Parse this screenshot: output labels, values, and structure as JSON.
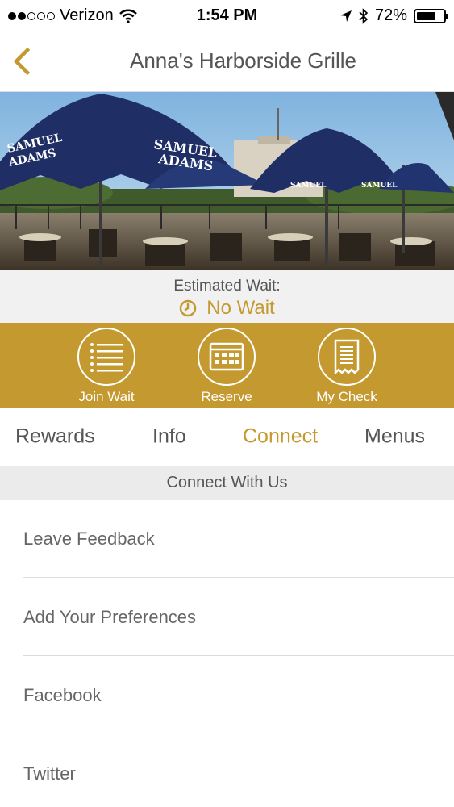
{
  "status_bar": {
    "carrier": "Verizon",
    "time": "1:54 PM",
    "battery": "72%",
    "signal_bars_filled": 2,
    "signal_bars_total": 5,
    "battery_level": 0.72
  },
  "nav": {
    "title": "Anna's Harborside Grille",
    "back_icon": "chevron-left-icon"
  },
  "hero": {
    "umbrella_text": [
      "SAMUEL",
      "ADAMS"
    ]
  },
  "wait": {
    "label": "Estimated Wait:",
    "value": "No Wait"
  },
  "actions": [
    {
      "label": "Join Wait",
      "icon": "list-icon"
    },
    {
      "label": "Reserve",
      "icon": "calendar-icon"
    },
    {
      "label": "My Check",
      "icon": "receipt-icon"
    }
  ],
  "tabs": [
    {
      "label": "Rewards",
      "active": false
    },
    {
      "label": "Info",
      "active": false
    },
    {
      "label": "Connect",
      "active": true
    },
    {
      "label": "Menus",
      "active": false
    }
  ],
  "section": {
    "title": "Connect With Us"
  },
  "list": [
    {
      "label": "Leave Feedback"
    },
    {
      "label": "Add Your Preferences"
    },
    {
      "label": "Facebook"
    },
    {
      "label": "Twitter"
    }
  ],
  "colors": {
    "accent": "#c4992f",
    "umbrella": "#1f2f66",
    "sky": "#9cc4e4"
  }
}
